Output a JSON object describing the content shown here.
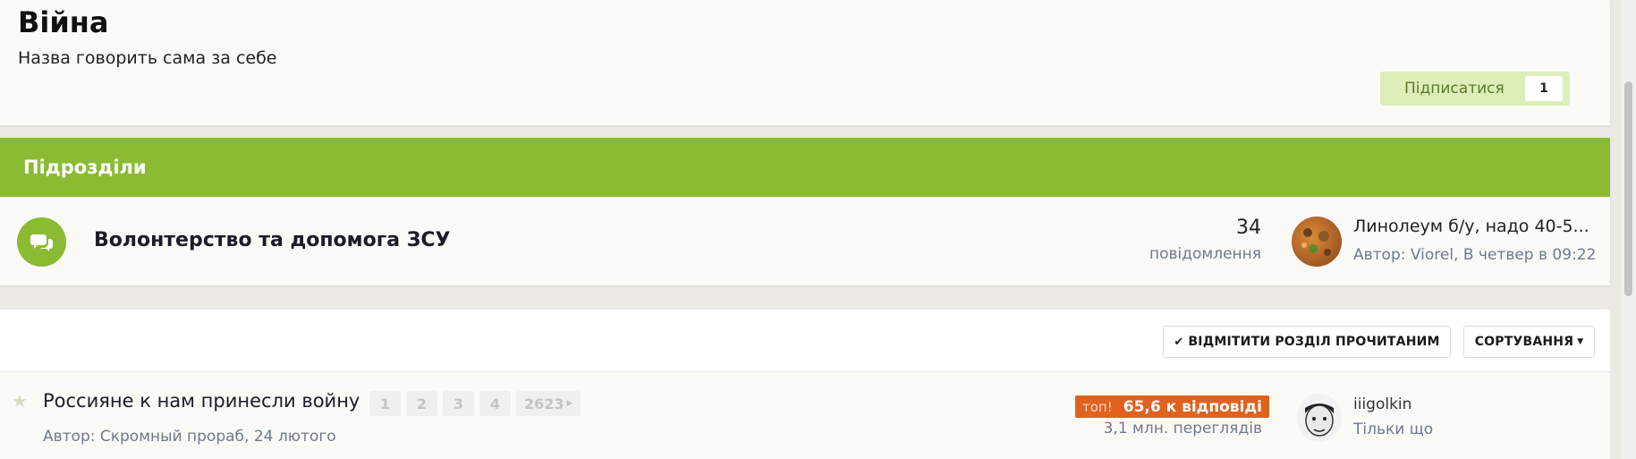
{
  "header": {
    "title": "Війна",
    "subtitle": "Назва говорить сама за себе",
    "follow_label": "Підписатися",
    "follow_count": "1"
  },
  "subforums": {
    "title": "Підрозділи",
    "items": [
      {
        "name": "Волонтерство та допомога ЗСУ",
        "count": "34",
        "count_label": "повідомлення",
        "last_post_title": "Линолеум б/у, надо 40-5...",
        "last_post_meta": "Автор: Viorel, В четвер в 09:22"
      }
    ]
  },
  "toolbar": {
    "mark_read_label": "ВІДМІТИТИ РОЗДІЛ ПРОЧИТАНИМ",
    "sort_label": "СОРТУВАННЯ"
  },
  "topics": [
    {
      "title": "Россияне к нам принесли войну",
      "pages": [
        "1",
        "2",
        "3",
        "4",
        "2623"
      ],
      "meta": "Автор: Скромный прораб, 24 лютого",
      "badge_label": "топ!",
      "replies": "65,6 к відповіді",
      "views": "3,1 млн. переглядів",
      "last_user": "iiigolkin",
      "last_time": "Тільки що"
    }
  ],
  "icons": {
    "follow": "none",
    "forum": "chat-bubbles-icon",
    "star": "star-icon",
    "check": "check-icon",
    "caret": "caret-down-icon",
    "next_page": "caret-right-icon"
  },
  "colors": {
    "accent_green": "#8abb33",
    "hot_orange": "#e0621e",
    "follow_bg": "#ddeeb9"
  }
}
